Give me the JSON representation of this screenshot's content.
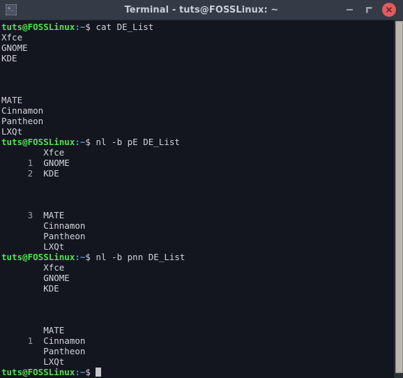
{
  "window": {
    "title": "Terminal - tuts@FOSSLinux: ~",
    "icon": "terminal-icon",
    "controls": {
      "minimize_label": "–",
      "maximize_label": "❐",
      "close_label": "×"
    },
    "colors": {
      "titlebar_bg": "#343a46",
      "terminal_bg": "#14161f",
      "text": "#d2d4d9",
      "prompt_user": "#4ee44e",
      "prompt_path": "#5b8fd6",
      "line_number": "#9aa0ab",
      "close_button": "#e05c5c",
      "scrollbar_thumb": "#b9b7ae"
    }
  },
  "terminal": {
    "prompt": {
      "user_host": "tuts@FOSSLinux",
      "path": ":~",
      "symbol": "$"
    },
    "lines": [
      {
        "type": "prompt",
        "command": "cat DE_List"
      },
      {
        "type": "output",
        "number": "",
        "text": "Xfce"
      },
      {
        "type": "output",
        "number": "",
        "text": "GNOME"
      },
      {
        "type": "output",
        "number": "",
        "text": "KDE"
      },
      {
        "type": "output",
        "number": "",
        "text": ""
      },
      {
        "type": "output",
        "number": "",
        "text": ""
      },
      {
        "type": "output",
        "number": "",
        "text": ""
      },
      {
        "type": "output",
        "number": "",
        "text": "MATE"
      },
      {
        "type": "output",
        "number": "",
        "text": "Cinnamon"
      },
      {
        "type": "output",
        "number": "",
        "text": "Pantheon"
      },
      {
        "type": "output",
        "number": "",
        "text": "LXQt"
      },
      {
        "type": "prompt",
        "command": "nl -b pE DE_List"
      },
      {
        "type": "numbered",
        "number": "      ",
        "text": "Xfce"
      },
      {
        "type": "numbered",
        "number": "     1",
        "text": "GNOME"
      },
      {
        "type": "numbered",
        "number": "     2",
        "text": "KDE"
      },
      {
        "type": "numbered",
        "number": "      ",
        "text": ""
      },
      {
        "type": "numbered",
        "number": "      ",
        "text": ""
      },
      {
        "type": "numbered",
        "number": "      ",
        "text": ""
      },
      {
        "type": "numbered",
        "number": "     3",
        "text": "MATE"
      },
      {
        "type": "numbered",
        "number": "      ",
        "text": "Cinnamon"
      },
      {
        "type": "numbered",
        "number": "      ",
        "text": "Pantheon"
      },
      {
        "type": "numbered",
        "number": "      ",
        "text": "LXQt"
      },
      {
        "type": "prompt",
        "command": "nl -b pnn DE_List"
      },
      {
        "type": "numbered",
        "number": "      ",
        "text": "Xfce"
      },
      {
        "type": "numbered",
        "number": "      ",
        "text": "GNOME"
      },
      {
        "type": "numbered",
        "number": "      ",
        "text": "KDE"
      },
      {
        "type": "numbered",
        "number": "      ",
        "text": ""
      },
      {
        "type": "numbered",
        "number": "      ",
        "text": ""
      },
      {
        "type": "numbered",
        "number": "      ",
        "text": ""
      },
      {
        "type": "numbered",
        "number": "      ",
        "text": "MATE"
      },
      {
        "type": "numbered",
        "number": "     1",
        "text": "Cinnamon"
      },
      {
        "type": "numbered",
        "number": "      ",
        "text": "Pantheon"
      },
      {
        "type": "numbered",
        "number": "      ",
        "text": "LXQt"
      },
      {
        "type": "cursor",
        "command": ""
      }
    ]
  }
}
